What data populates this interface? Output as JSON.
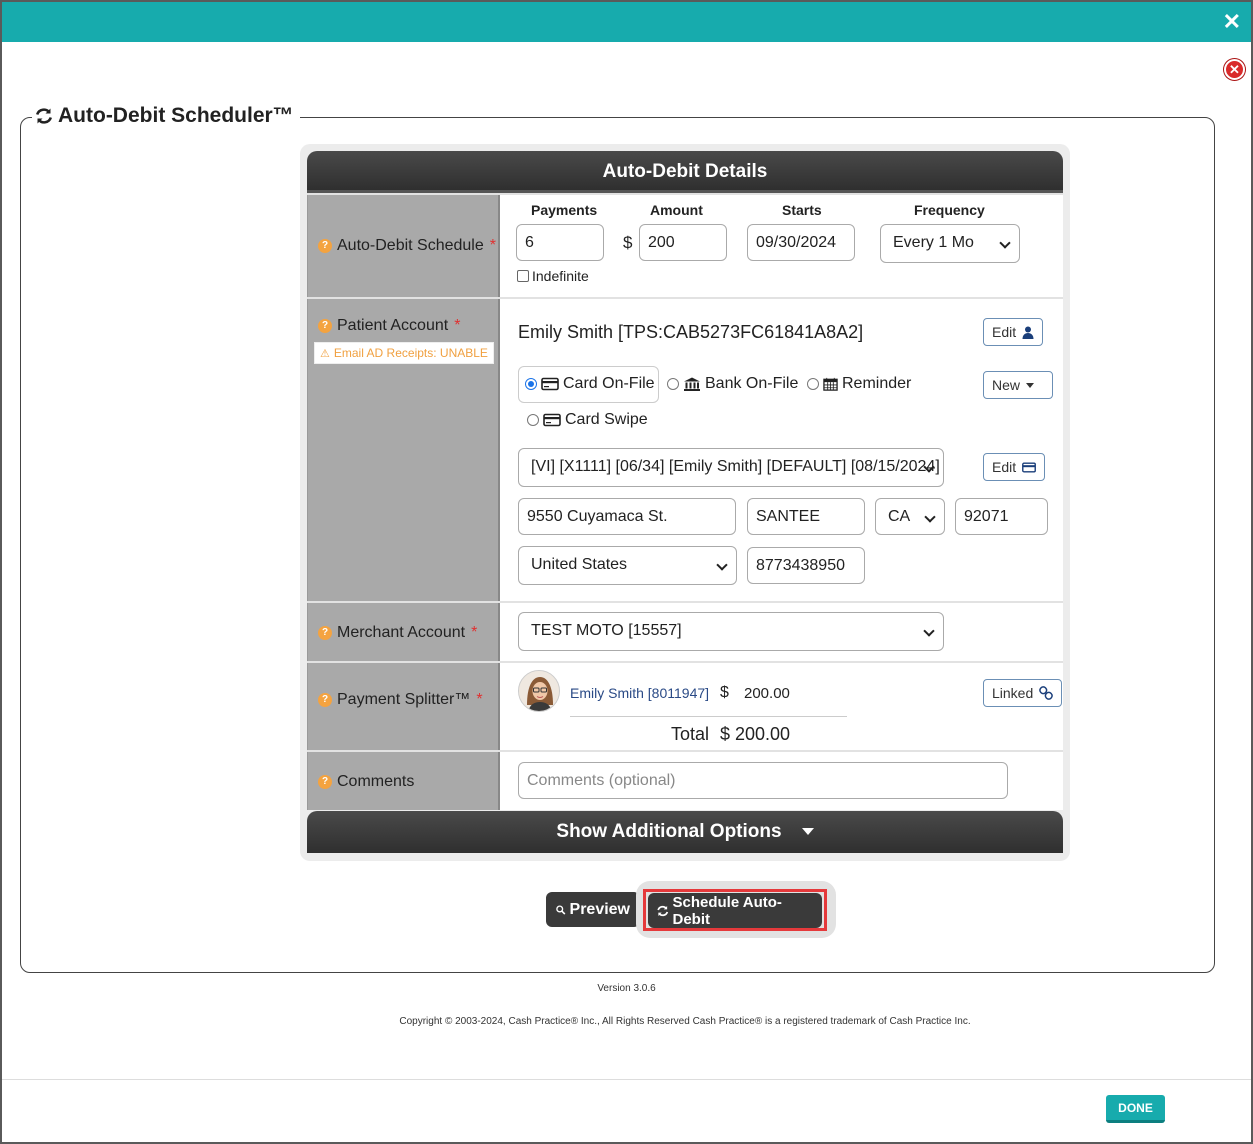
{
  "window": {
    "close_icon": "times-icon"
  },
  "scheduler": {
    "title": "Auto-Debit Scheduler™",
    "panel_title": "Auto-Debit Details",
    "schedule": {
      "label": "Auto-Debit Schedule",
      "required": "*",
      "col_payments": "Payments",
      "col_amount": "Amount",
      "col_starts": "Starts",
      "col_frequency": "Frequency",
      "payments_value": "6",
      "currency": "$",
      "amount_value": "200",
      "starts_value": "09/30/2024",
      "frequency_value": "Every 1 Mo",
      "indefinite_label": "Indefinite"
    },
    "patient": {
      "label": "Patient Account",
      "required": "*",
      "warning": "Email AD Receipts: UNABLE",
      "name": "Emily Smith [TPS:CAB5273FC61841A8A2]",
      "edit_label": "Edit",
      "new_label": "New",
      "edit_card_label": "Edit",
      "opt_card_on_file": "Card On-File",
      "opt_bank_on_file": "Bank On-File",
      "opt_reminder": "Reminder",
      "opt_card_swipe": "Card Swipe",
      "card_select": "[VI] [X1111] [06/34] [Emily Smith] [DEFAULT] [08/15/2024]",
      "address": "9550 Cuyamaca St.",
      "city": "SANTEE",
      "state": "CA",
      "zip": "92071",
      "country": "United States",
      "phone": "8773438950"
    },
    "merchant": {
      "label": "Merchant Account",
      "required": "*",
      "value": "TEST MOTO [15557]"
    },
    "splitter": {
      "label": "Payment Splitter™",
      "required": "*",
      "name": "Emily Smith [8011947]",
      "currency": "$",
      "amount": "200.00",
      "linked_label": "Linked",
      "total_label": "Total",
      "total_value": "$ 200.00"
    },
    "comments": {
      "label": "Comments",
      "placeholder": "Comments (optional)"
    },
    "additional_options": "Show Additional Options",
    "preview_label": "Preview",
    "schedule_label": "Schedule Auto-Debit"
  },
  "footer": {
    "version": "Version 3.0.6",
    "copyright": "Copyright © 2003-2024, Cash Practice® Inc., All Rights Reserved Cash Practice® is a registered trademark of Cash Practice Inc.",
    "done_label": "DONE"
  }
}
